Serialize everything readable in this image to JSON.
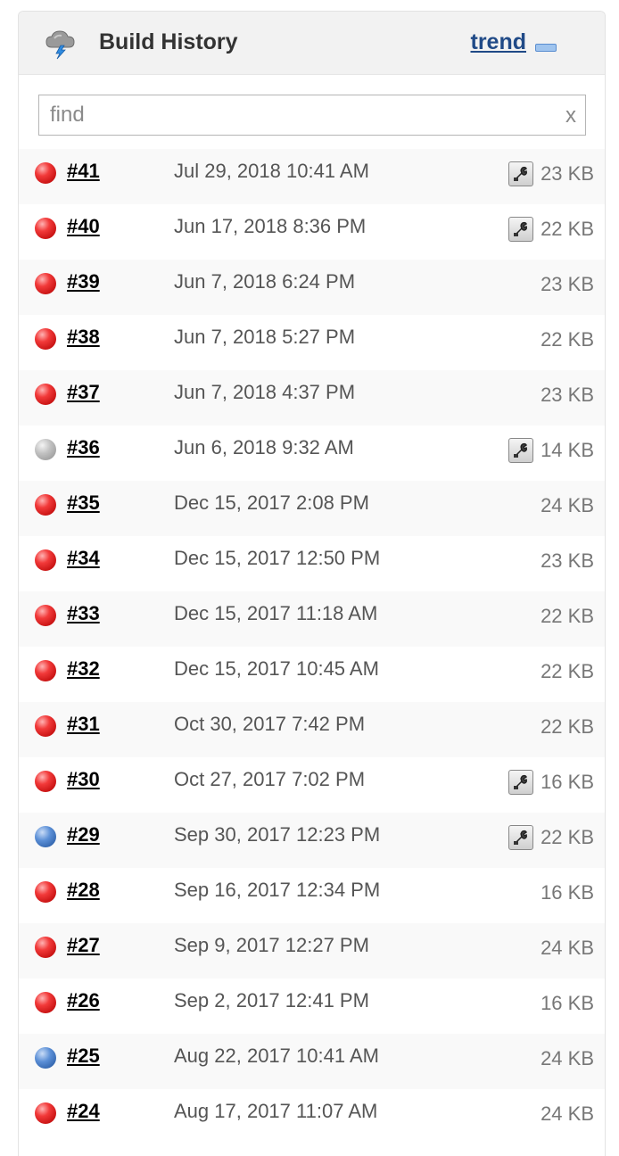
{
  "header": {
    "title": "Build History",
    "trend_label": "trend",
    "icon": "weather-cloud-lightning-icon"
  },
  "search": {
    "placeholder": "find",
    "clear_label": "x"
  },
  "colors": {
    "failed": "#e02020",
    "aborted": "#aaaaaa",
    "success": "#3d6fb8",
    "link": "#204a87"
  },
  "builds": [
    {
      "number": "#41",
      "date": "Jul 29, 2018 10:41 AM",
      "size": "23 KB",
      "status": "failed",
      "has_console_icon": true
    },
    {
      "number": "#40",
      "date": "Jun 17, 2018 8:36 PM",
      "size": "22 KB",
      "status": "failed",
      "has_console_icon": true
    },
    {
      "number": "#39",
      "date": "Jun 7, 2018 6:24 PM",
      "size": "23 KB",
      "status": "failed",
      "has_console_icon": false
    },
    {
      "number": "#38",
      "date": "Jun 7, 2018 5:27 PM",
      "size": "22 KB",
      "status": "failed",
      "has_console_icon": false
    },
    {
      "number": "#37",
      "date": "Jun 7, 2018 4:37 PM",
      "size": "23 KB",
      "status": "failed",
      "has_console_icon": false
    },
    {
      "number": "#36",
      "date": "Jun 6, 2018 9:32 AM",
      "size": "14 KB",
      "status": "aborted",
      "has_console_icon": true
    },
    {
      "number": "#35",
      "date": "Dec 15, 2017 2:08 PM",
      "size": "24 KB",
      "status": "failed",
      "has_console_icon": false
    },
    {
      "number": "#34",
      "date": "Dec 15, 2017 12:50 PM",
      "size": "23 KB",
      "status": "failed",
      "has_console_icon": false
    },
    {
      "number": "#33",
      "date": "Dec 15, 2017 11:18 AM",
      "size": "22 KB",
      "status": "failed",
      "has_console_icon": false
    },
    {
      "number": "#32",
      "date": "Dec 15, 2017 10:45 AM",
      "size": "22 KB",
      "status": "failed",
      "has_console_icon": false
    },
    {
      "number": "#31",
      "date": "Oct 30, 2017 7:42 PM",
      "size": "22 KB",
      "status": "failed",
      "has_console_icon": false
    },
    {
      "number": "#30",
      "date": "Oct 27, 2017 7:02 PM",
      "size": "16 KB",
      "status": "failed",
      "has_console_icon": true
    },
    {
      "number": "#29",
      "date": "Sep 30, 2017 12:23 PM",
      "size": "22 KB",
      "status": "success",
      "has_console_icon": true
    },
    {
      "number": "#28",
      "date": "Sep 16, 2017 12:34 PM",
      "size": "16 KB",
      "status": "failed",
      "has_console_icon": false
    },
    {
      "number": "#27",
      "date": "Sep 9, 2017 12:27 PM",
      "size": "24 KB",
      "status": "failed",
      "has_console_icon": false
    },
    {
      "number": "#26",
      "date": "Sep 2, 2017 12:41 PM",
      "size": "16 KB",
      "status": "failed",
      "has_console_icon": false
    },
    {
      "number": "#25",
      "date": "Aug 22, 2017 10:41 AM",
      "size": "24 KB",
      "status": "success",
      "has_console_icon": false
    },
    {
      "number": "#24",
      "date": "Aug 17, 2017 11:07 AM",
      "size": "24 KB",
      "status": "failed",
      "has_console_icon": false
    }
  ]
}
